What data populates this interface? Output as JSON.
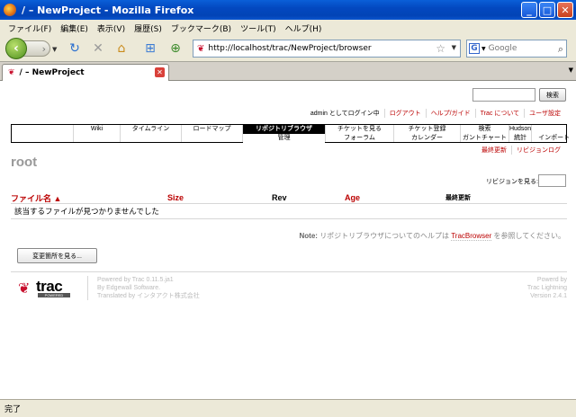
{
  "window": {
    "title": "/ – NewProject - Mozilla Firefox"
  },
  "menu": [
    "ファイル(F)",
    "編集(E)",
    "表示(V)",
    "履歴(S)",
    "ブックマーク(B)",
    "ツール(T)",
    "ヘルプ(H)"
  ],
  "toolbar": {
    "url": "http://localhost/trac/NewProject/browser",
    "search_placeholder": "Google"
  },
  "tab": {
    "title": "/ – NewProject"
  },
  "trac": {
    "search_button": "検索",
    "metanav": [
      "admin としてログイン中",
      "ログアウト",
      "ヘルプ/ガイド",
      "Trac について",
      "ユーザ設定"
    ],
    "mainnav": [
      {
        "top": "Wiki",
        "bottom": ""
      },
      {
        "top": "タイムライン",
        "bottom": ""
      },
      {
        "top": "ロードマップ",
        "bottom": ""
      },
      {
        "top": "リポジトリブラウザ",
        "bottom": "管理"
      },
      {
        "top": "チケットを見る",
        "bottom": "フォーラム"
      },
      {
        "top": "チケット登録",
        "bottom": "カレンダー"
      },
      {
        "top": "検索",
        "bottom": "ガントチャート"
      },
      {
        "top": "Hudson",
        "bottom": "統計"
      },
      {
        "top": "",
        "bottom": "インポート"
      }
    ],
    "ctxtnav": [
      "最終更新",
      "リビジョンログ"
    ],
    "page_title": "root",
    "revision_label": "リビジョンを見る:",
    "columns": [
      "ファイル名 ▲",
      "Size",
      "Rev",
      "Age",
      "最終更新"
    ],
    "empty_row": "該当するファイルが見つかりませんでした",
    "note_label": "Note:",
    "note_text_before": "リポジトリブラウザについてのヘルプは",
    "note_link": "TracBrowser",
    "note_text_after": "を参照してください。",
    "changes_button": "変更箇所を見る...",
    "footer_left": [
      "Powered by Trac 0.11.5.ja1",
      "By Edgewall Software.",
      "Translated by インタアクト株式会社"
    ],
    "footer_right": [
      "Powerd by",
      "Trac Lightning",
      "Version 2.4.1"
    ]
  },
  "status": {
    "text": "完了"
  }
}
